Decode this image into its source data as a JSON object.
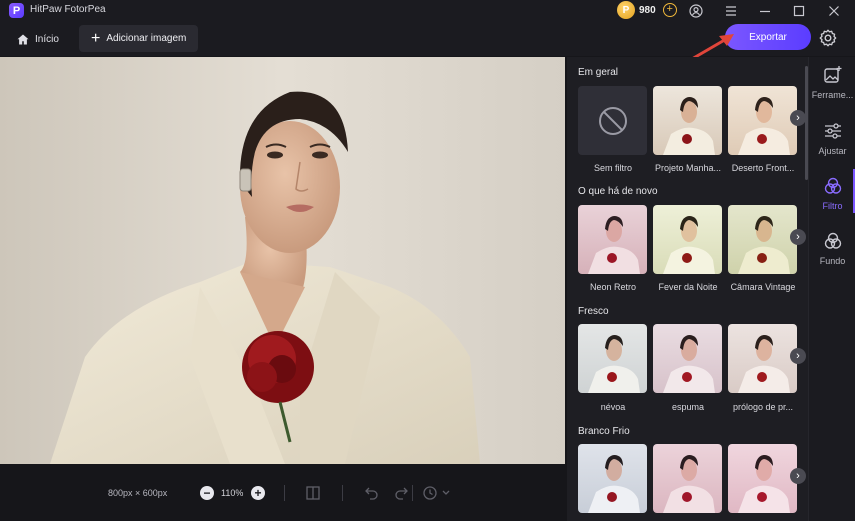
{
  "app": {
    "logo_letter": "P",
    "title": "HitPaw FotorPea"
  },
  "credits": {
    "count": "980",
    "coin_symbol": "P"
  },
  "toolbar": {
    "home_label": "Início",
    "add_image_label": "Adicionar imagem",
    "export_label": "Exportar"
  },
  "canvas_footer": {
    "image_size": "800px × 600px",
    "zoom_level": "110%"
  },
  "filters": {
    "sections": [
      {
        "title": "Em geral",
        "items": [
          "Sem filtro",
          "Projeto Manha...",
          "Deserto Front..."
        ]
      },
      {
        "title": "O que há de novo",
        "items": [
          "Neon Retro",
          "Fever da Noite",
          "Câmara Vintage"
        ]
      },
      {
        "title": "Fresco",
        "items": [
          "névoa",
          "espuma",
          "prólogo de pr..."
        ]
      },
      {
        "title": "Branco Frio",
        "items": [
          "",
          "",
          ""
        ]
      }
    ]
  },
  "rail": {
    "items": [
      {
        "label": "Ferrame...",
        "icon": "magic-image-icon"
      },
      {
        "label": "Ajustar",
        "icon": "sliders-icon"
      },
      {
        "label": "Filtro",
        "icon": "filter-circles-icon",
        "active": true
      },
      {
        "label": "Fundo",
        "icon": "background-circles-icon"
      }
    ]
  },
  "colors": {
    "accent": "#7b57ff",
    "annotation_arrow": "#e0453a",
    "panel_bg": "#1e1e23"
  }
}
